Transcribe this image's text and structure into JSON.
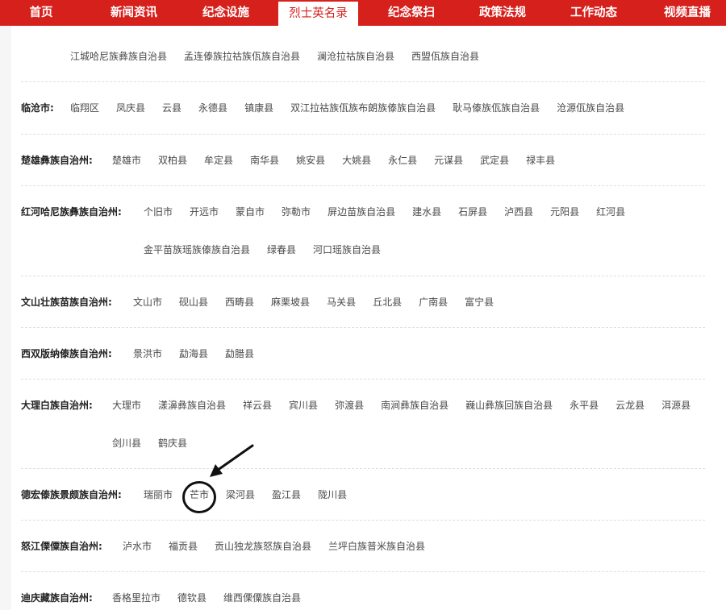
{
  "nav": {
    "items": [
      "首页",
      "新闻资讯",
      "纪念设施",
      "烈士英名录",
      "纪念祭扫",
      "政策法规",
      "工作动态",
      "视频直播"
    ],
    "active_index": 3
  },
  "regions": [
    {
      "label": "",
      "lines": [
        [
          "江城哈尼族彝族自治县",
          "孟连傣族拉祜族佤族自治县",
          "澜沧拉祜族自治县",
          "西盟佤族自治县"
        ]
      ]
    },
    {
      "label": "临沧市:",
      "lines": [
        [
          "临翔区",
          "凤庆县",
          "云县",
          "永德县",
          "镇康县",
          "双江拉祜族佤族布朗族傣族自治县",
          "耿马傣族佤族自治县",
          "沧源佤族自治县"
        ]
      ]
    },
    {
      "label": "楚雄彝族自治州:",
      "lines": [
        [
          "楚雄市",
          "双柏县",
          "牟定县",
          "南华县",
          "姚安县",
          "大姚县",
          "永仁县",
          "元谋县",
          "武定县",
          "禄丰县"
        ]
      ]
    },
    {
      "label": "红河哈尼族彝族自治州:",
      "lines": [
        [
          "个旧市",
          "开远市",
          "蒙自市",
          "弥勒市",
          "屏边苗族自治县",
          "建水县",
          "石屏县",
          "泸西县",
          "元阳县",
          "红河县"
        ],
        [
          "金平苗族瑶族傣族自治县",
          "绿春县",
          "河口瑶族自治县"
        ]
      ]
    },
    {
      "label": "文山壮族苗族自治州:",
      "lines": [
        [
          "文山市",
          "砚山县",
          "西畴县",
          "麻栗坡县",
          "马关县",
          "丘北县",
          "广南县",
          "富宁县"
        ]
      ]
    },
    {
      "label": "西双版纳傣族自治州:",
      "lines": [
        [
          "景洪市",
          "勐海县",
          "勐腊县"
        ]
      ]
    },
    {
      "label": "大理白族自治州:",
      "lines": [
        [
          "大理市",
          "漾濞彝族自治县",
          "祥云县",
          "宾川县",
          "弥渡县",
          "南涧彝族自治县",
          "巍山彝族回族自治县",
          "永平县",
          "云龙县",
          "洱源县"
        ],
        [
          "剑川县",
          "鹤庆县"
        ]
      ]
    },
    {
      "label": "德宏傣族景颇族自治州:",
      "lines": [
        [
          "瑞丽市",
          "芒市",
          "梁河县",
          "盈江县",
          "陇川县"
        ]
      ]
    },
    {
      "label": "怒江傈僳族自治州:",
      "lines": [
        [
          "泸水市",
          "福贡县",
          "贡山独龙族怒族自治县",
          "兰坪白族普米族自治县"
        ]
      ]
    },
    {
      "label": "迪庆藏族自治州:",
      "lines": [
        [
          "香格里拉市",
          "德钦县",
          "维西傈僳族自治县"
        ]
      ]
    }
  ]
}
